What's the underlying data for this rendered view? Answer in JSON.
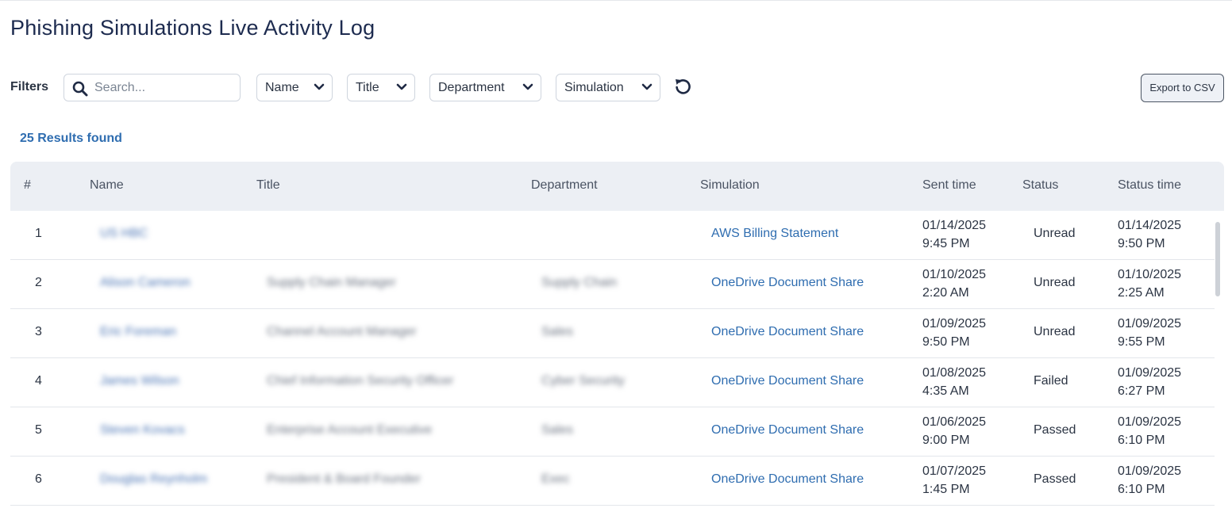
{
  "page": {
    "title": "Phishing Simulations Live Activity Log"
  },
  "filters": {
    "label": "Filters",
    "search_placeholder": "Search...",
    "dropdowns": [
      "Name",
      "Title",
      "Department",
      "Simulation"
    ],
    "export_label": "Export to CSV"
  },
  "results_label": "25 Results found",
  "table": {
    "columns": [
      "#",
      "Name",
      "Title",
      "Department",
      "Simulation",
      "Sent time",
      "Status",
      "Status time"
    ],
    "rows": [
      {
        "num": "1",
        "name": "US HBC",
        "title": "",
        "department": "",
        "simulation": "AWS Billing Statement",
        "sent_date": "01/14/2025",
        "sent_time": "9:45 PM",
        "status": "Unread",
        "status_date": "01/14/2025",
        "status_time": "9:50 PM"
      },
      {
        "num": "2",
        "name": "Alison Cameron",
        "title": "Supply Chain Manager",
        "department": "Supply Chain",
        "simulation": "OneDrive Document Share",
        "sent_date": "01/10/2025",
        "sent_time": "2:20 AM",
        "status": "Unread",
        "status_date": "01/10/2025",
        "status_time": "2:25 AM"
      },
      {
        "num": "3",
        "name": "Eric Foreman",
        "title": "Channel Account Manager",
        "department": "Sales",
        "simulation": "OneDrive Document Share",
        "sent_date": "01/09/2025",
        "sent_time": "9:50 PM",
        "status": "Unread",
        "status_date": "01/09/2025",
        "status_time": "9:55 PM"
      },
      {
        "num": "4",
        "name": "James Wilson",
        "title": "Chief Information Security Officer",
        "department": "Cyber Security",
        "simulation": "OneDrive Document Share",
        "sent_date": "01/08/2025",
        "sent_time": "4:35 AM",
        "status": "Failed",
        "status_date": "01/09/2025",
        "status_time": "6:27 PM"
      },
      {
        "num": "5",
        "name": "Steven Kovacs",
        "title": "Enterprise Account Executive",
        "department": "Sales",
        "simulation": "OneDrive Document Share",
        "sent_date": "01/06/2025",
        "sent_time": "9:00 PM",
        "status": "Passed",
        "status_date": "01/09/2025",
        "status_time": "6:10 PM"
      },
      {
        "num": "6",
        "name": "Douglas Reynholm",
        "title": "President & Board Founder",
        "department": "Exec",
        "simulation": "OneDrive Document Share",
        "sent_date": "01/07/2025",
        "sent_time": "1:45 PM",
        "status": "Passed",
        "status_date": "01/09/2025",
        "status_time": "6:10 PM"
      }
    ]
  },
  "icons": {
    "search": "search-icon",
    "dropdown": "chevron-down-icon",
    "reset": "refresh-icon"
  },
  "colors": {
    "link": "#2f6db0",
    "header_bg": "#eceff4",
    "title": "#1d2b4f"
  }
}
